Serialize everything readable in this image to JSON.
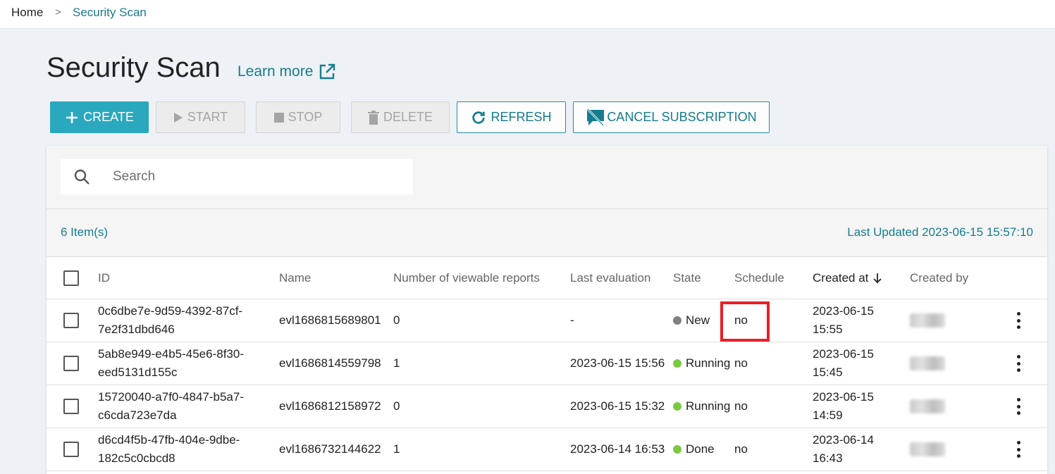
{
  "breadcrumb": {
    "home": "Home",
    "separator": ">",
    "current": "Security Scan"
  },
  "page": {
    "title": "Security Scan",
    "learn_more": "Learn more"
  },
  "toolbar": {
    "create": "CREATE",
    "start": "START",
    "stop": "STOP",
    "delete": "DELETE",
    "refresh": "REFRESH",
    "cancel_subscription": "CANCEL SUBSCRIPTION"
  },
  "search": {
    "placeholder": "Search"
  },
  "summary": {
    "count": "6 Item(s)",
    "last_updated": "Last Updated 2023-06-15 15:57:10"
  },
  "table": {
    "columns": {
      "id": "ID",
      "name": "Name",
      "reports": "Number of viewable reports",
      "last_eval": "Last evaluation",
      "state": "State",
      "schedule": "Schedule",
      "created_at": "Created at",
      "created_by": "Created by"
    },
    "sorted_column": "created_at",
    "sort_direction": "descending",
    "rows": [
      {
        "id_line1": "0c6dbe7e-9d59-4392-87cf-",
        "id_line2": "7e2f31dbd646",
        "name": "evl1686815689801",
        "reports": "0",
        "last_eval": "-",
        "state": "New",
        "state_color": "#808080",
        "schedule": "no",
        "created_line1": "2023-06-15",
        "created_line2": "15:55"
      },
      {
        "id_line1": "5ab8e949-e4b5-45e6-8f30-",
        "id_line2": "eed5131d155c",
        "name": "evl1686814559798",
        "reports": "1",
        "last_eval": "2023-06-15 15:56",
        "state": "Running",
        "state_color": "#7ac943",
        "schedule": "no",
        "created_line1": "2023-06-15",
        "created_line2": "15:45"
      },
      {
        "id_line1": "15720040-a7f0-4847-b5a7-",
        "id_line2": "c6cda723e7da",
        "name": "evl1686812158972",
        "reports": "0",
        "last_eval": "2023-06-15 15:32",
        "state": "Running",
        "state_color": "#7ac943",
        "schedule": "no",
        "created_line1": "2023-06-15",
        "created_line2": "14:59"
      },
      {
        "id_line1": "d6cd4f5b-47fb-404e-9dbe-",
        "id_line2": "182c5c0cbcd8",
        "name": "evl1686732144622",
        "reports": "1",
        "last_eval": "2023-06-14 16:53",
        "state": "Done",
        "state_color": "#7ac943",
        "schedule": "no",
        "created_line1": "2023-06-14",
        "created_line2": "16:43"
      }
    ]
  },
  "colors": {
    "accent": "#2aa8be",
    "link": "#157c8f",
    "highlight": "#e8202a"
  }
}
